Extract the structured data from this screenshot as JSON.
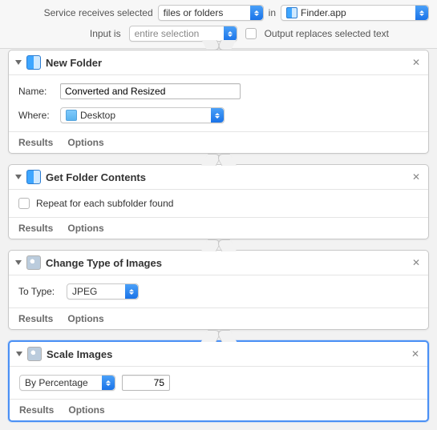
{
  "topbar": {
    "service_receives_label": "Service receives selected",
    "input_type": "files or folders",
    "in_label": "in",
    "app": "Finder.app",
    "input_is_label": "Input is",
    "input_scope": "entire selection",
    "output_replaces_label": "Output replaces selected text"
  },
  "actions": {
    "new_folder": {
      "title": "New Folder",
      "name_label": "Name:",
      "name_value": "Converted and Resized",
      "where_label": "Where:",
      "where_value": "Desktop"
    },
    "get_contents": {
      "title": "Get Folder Contents",
      "repeat_label": "Repeat for each subfolder found"
    },
    "change_type": {
      "title": "Change Type of Images",
      "to_type_label": "To Type:",
      "to_type_value": "JPEG"
    },
    "scale_images": {
      "title": "Scale Images",
      "mode": "By Percentage",
      "value": "75"
    }
  },
  "footer": {
    "results": "Results",
    "options": "Options"
  }
}
